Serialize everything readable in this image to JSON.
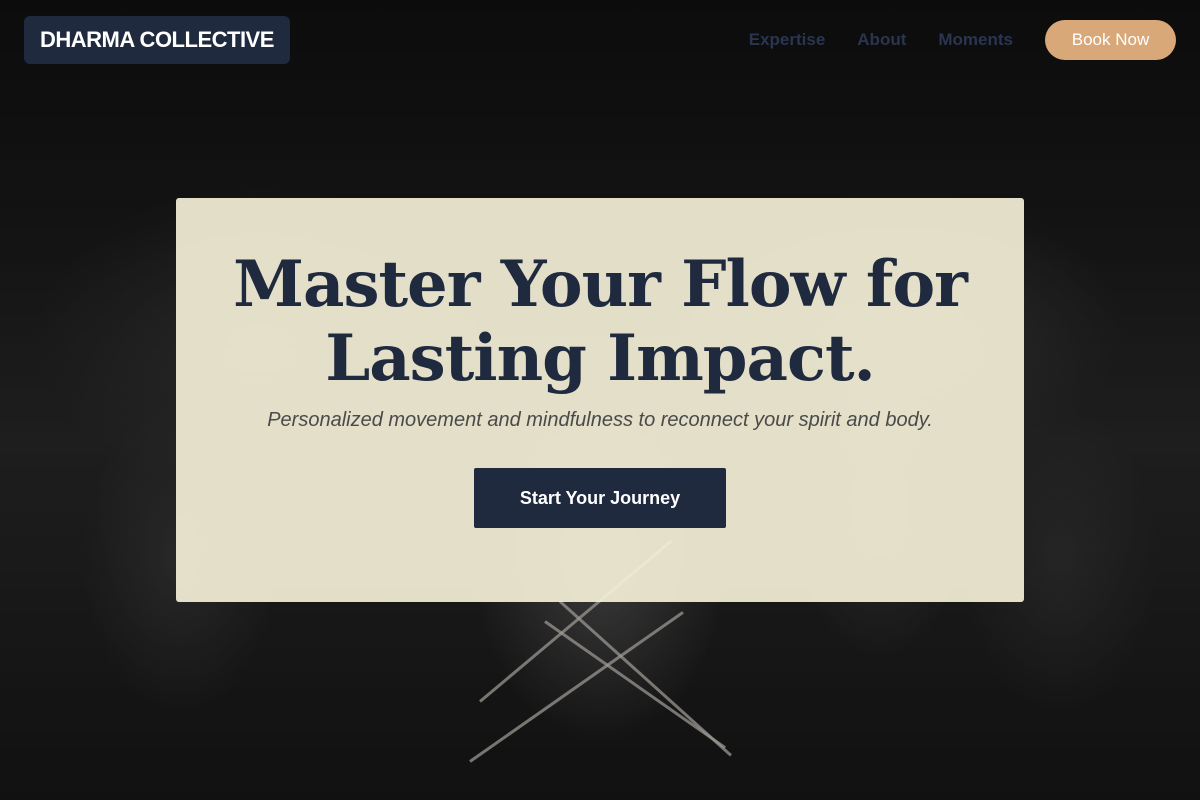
{
  "brand": {
    "name": "DHARMA COLLECTIVE"
  },
  "nav": {
    "links": [
      "Expertise",
      "About",
      "Moments"
    ],
    "book_label": "Book Now"
  },
  "hero": {
    "title": "Master Your Flow for Lasting Impact.",
    "subtitle": "Personalized movement and mindfulness to reconnect your spirit and body.",
    "cta_label": "Start Your Journey",
    "background": "black-and-white yoga class photo"
  },
  "colors": {
    "navy": "#1f2a3f",
    "accent": "#d9a878",
    "card": "#f5f0d7"
  }
}
